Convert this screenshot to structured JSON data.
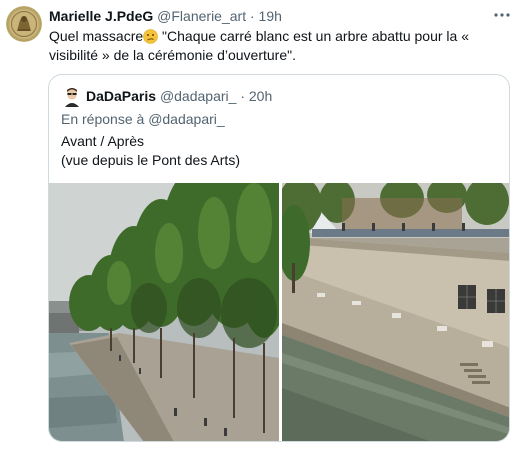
{
  "tweet": {
    "author_name": "Marielle J.PdeG",
    "author_handle": "@Flanerie_art",
    "separator": "·",
    "time": "19h",
    "more_label": "•••",
    "text_before_emoji": "Quel massacre",
    "emoji": "confused-face-emoji",
    "text_after_emoji": "  \"Chaque carré blanc est un arbre abattu pour la « visibilité » de la cérémonie d’ouverture\"."
  },
  "quoted_tweet": {
    "author_name": "DaDaParis",
    "author_handle": "@dadapari_",
    "separator": "·",
    "time": "20h",
    "reply_prefix": "En réponse à",
    "reply_mention": "@dadapari_",
    "text_line1": "Avant / Après",
    "text_line2": "(vue depuis le Pont des Arts)",
    "photos": [
      {
        "description_icon": "before-photo"
      },
      {
        "description_icon": "after-photo"
      }
    ]
  },
  "colors": {
    "text": "#0f1419",
    "secondary": "#536471",
    "border": "#cfd9de"
  }
}
